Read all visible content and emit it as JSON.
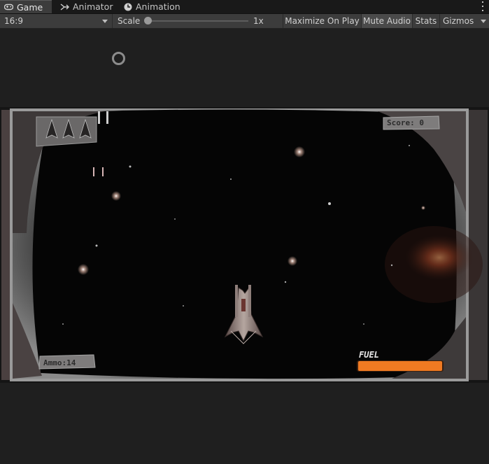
{
  "tabs": [
    {
      "label": "Game",
      "icon": "gamepad-icon",
      "active": true
    },
    {
      "label": "Animator",
      "icon": "animator-icon",
      "active": false
    },
    {
      "label": "Animation",
      "icon": "animation-clock-icon",
      "active": false
    }
  ],
  "toolbar": {
    "aspect": "16:9",
    "scale_label": "Scale",
    "scale_value": "1x",
    "scale_level": 0.0,
    "maximize_label": "Maximize On Play",
    "mute_label": "Mute Audio",
    "mute_active": true,
    "stats_label": "Stats",
    "gizmos_label": "Gizmos"
  },
  "game": {
    "score_text": "Score: 0",
    "ammo_text": "Ammo:14",
    "fuel_label": "FUEL",
    "fuel_level": 1.0,
    "lives_count": 3,
    "colors": {
      "fuel": "#f07a22",
      "space": "#050505",
      "frame": "#6e6e6e"
    }
  }
}
